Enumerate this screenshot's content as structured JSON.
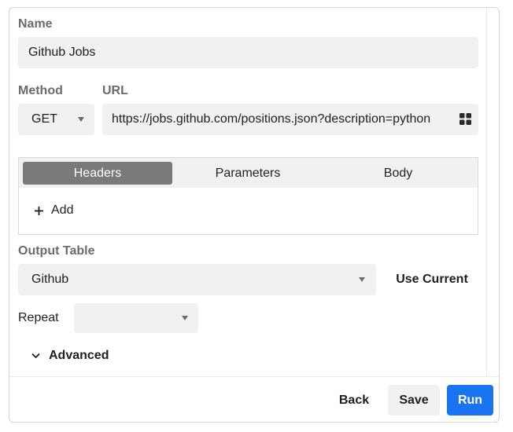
{
  "form": {
    "name_label": "Name",
    "name_value": "Github Jobs",
    "method_label": "Method",
    "method_value": "GET",
    "url_label": "URL",
    "url_value": "https://jobs.github.com/positions.json?description=python",
    "tabs": [
      {
        "label": "Headers",
        "active": true
      },
      {
        "label": "Parameters",
        "active": false
      },
      {
        "label": "Body",
        "active": false
      }
    ],
    "add_label": "Add",
    "output_table_label": "Output Table",
    "output_table_value": "Github",
    "use_current_label": "Use Current",
    "repeat_label": "Repeat",
    "repeat_value": "",
    "advanced_label": "Advanced"
  },
  "footer": {
    "back_label": "Back",
    "save_label": "Save",
    "run_label": "Run"
  },
  "colors": {
    "primary": "#1a73f0",
    "field_bg": "#f1f1f1",
    "active_tab": "#7a7a7a"
  },
  "icons": {
    "url_action": "grid-icon",
    "add": "plus-icon",
    "advanced": "chevron-down-icon"
  }
}
